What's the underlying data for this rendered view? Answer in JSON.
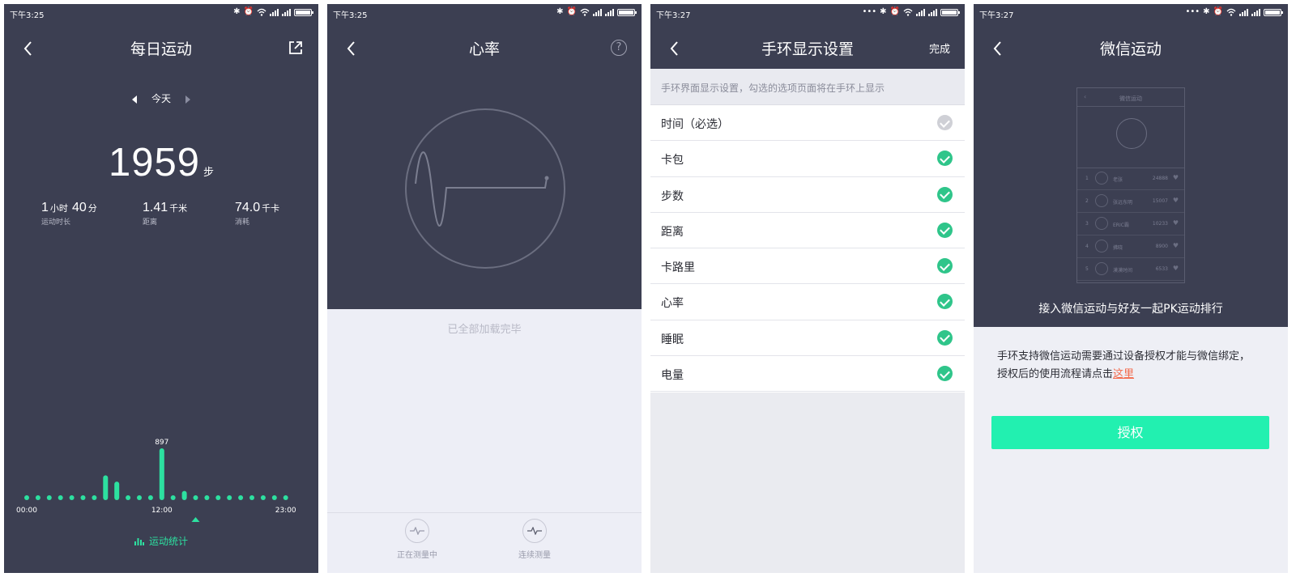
{
  "screens": [
    {
      "status_time": "下午3:25",
      "title": "每日运动",
      "date_label": "今天",
      "steps": "1959",
      "steps_unit": "步",
      "metrics": [
        {
          "value": "1",
          "unit": "小时",
          "value2": "40",
          "unit2": "分",
          "label": "运动时长"
        },
        {
          "value": "1.41",
          "unit": "千米",
          "label": "距离"
        },
        {
          "value": "74.0",
          "unit": "千卡",
          "label": "消耗"
        }
      ],
      "chart_stats_label": "运动统计",
      "chart_data": {
        "type": "bar",
        "title": "",
        "xlabel": "",
        "ylabel": "",
        "x_tick_labels": [
          "00:00",
          "12:00",
          "23:00"
        ],
        "peak_label": "897",
        "categories": [
          "0",
          "1",
          "2",
          "3",
          "4",
          "5",
          "6",
          "7",
          "8",
          "9",
          "10",
          "11",
          "12",
          "13",
          "14",
          "15",
          "16",
          "17",
          "18",
          "19",
          "20",
          "21",
          "22",
          "23"
        ],
        "values": [
          0,
          0,
          0,
          0,
          0,
          0,
          0,
          0,
          0,
          0,
          0,
          0,
          897,
          0,
          0,
          0,
          0,
          0,
          0,
          0,
          0,
          0,
          0,
          0
        ],
        "values_estimated": [
          10,
          10,
          10,
          10,
          10,
          10,
          10,
          430,
          320,
          10,
          10,
          10,
          897,
          10,
          160,
          10,
          10,
          10,
          10,
          10,
          10,
          10,
          10,
          10
        ],
        "color": "#2de0a0"
      }
    },
    {
      "status_time": "下午3:25",
      "title": "心率",
      "help_icon": "?",
      "loaded_text": "已全部加载完毕",
      "buttons": [
        "正在测量中",
        "连续测量"
      ]
    },
    {
      "status_time": "下午3:27",
      "title": "手环显示设置",
      "done_label": "完成",
      "hint": "手环界面显示设置，勾选的选项页面将在手环上显示",
      "items": [
        {
          "label": "时间（必选）",
          "checked": true,
          "locked": true
        },
        {
          "label": "卡包",
          "checked": true
        },
        {
          "label": "步数",
          "checked": true
        },
        {
          "label": "距离",
          "checked": true
        },
        {
          "label": "卡路里",
          "checked": true
        },
        {
          "label": "心率",
          "checked": true
        },
        {
          "label": "睡眠",
          "checked": true
        },
        {
          "label": "电量",
          "checked": true
        }
      ]
    },
    {
      "status_time": "下午3:27",
      "title": "微信运动",
      "mock": {
        "title": "微信运动",
        "rows": [
          {
            "rank": "1",
            "name": "老张",
            "score": "24888"
          },
          {
            "rank": "2",
            "name": "张远东明",
            "score": "15007"
          },
          {
            "rank": "3",
            "name": "ERIC霸",
            "score": "10233"
          },
          {
            "rank": "4",
            "name": "拂晓",
            "score": "8900"
          },
          {
            "rank": "5",
            "name": "漠漠时间",
            "score": "6533"
          }
        ]
      },
      "pk_text": "接入微信运动与好友一起PK运动排行",
      "desc_line1": "手环支持微信运动需要通过设备授权才能与微信绑定，",
      "desc_line2": "授权后的使用流程请点击",
      "desc_link": "这里",
      "auth_label": "授权"
    }
  ],
  "colors": {
    "dark_bg": "#3c3f52",
    "accent_green": "#2de0a0",
    "check_green": "#2fc58a",
    "button_green": "#22f0b0",
    "link_red": "#f36a4c"
  }
}
